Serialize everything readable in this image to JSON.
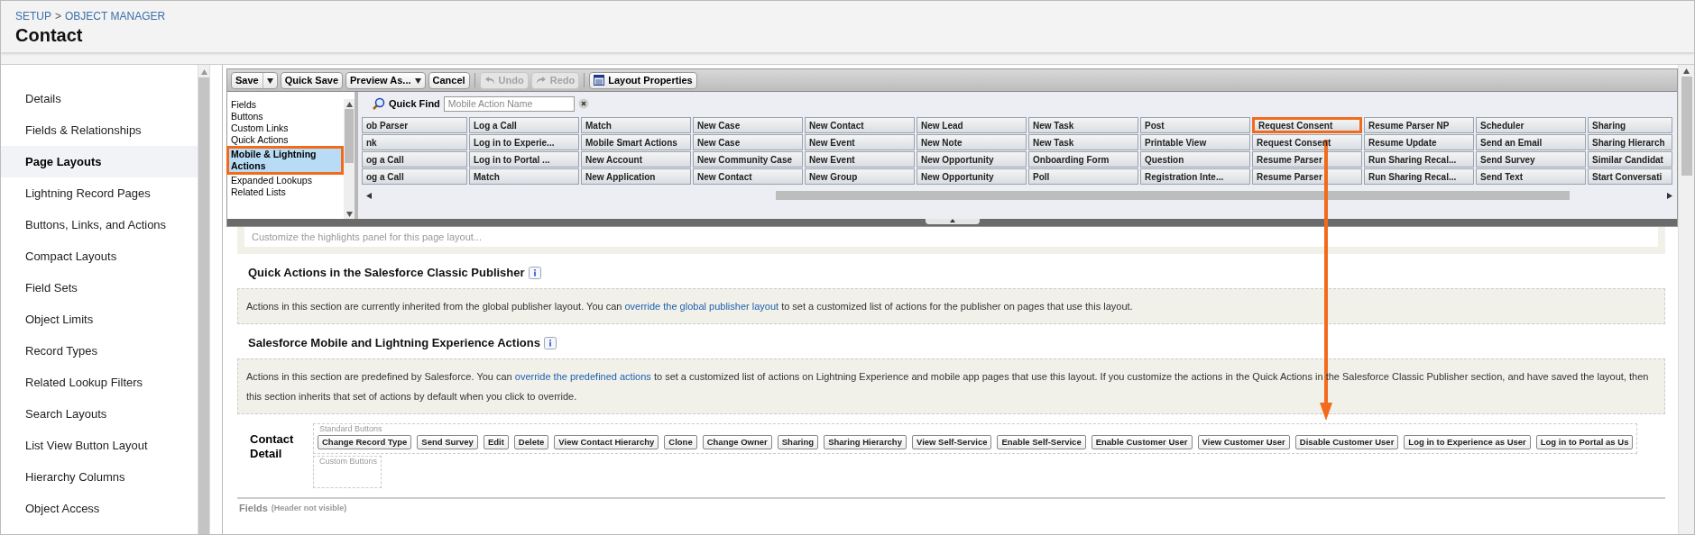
{
  "header": {
    "breadcrumb": [
      "SETUP",
      "OBJECT MANAGER"
    ],
    "separator": ">",
    "title": "Contact"
  },
  "sidebar": {
    "items": [
      {
        "label": "Details",
        "selected": false
      },
      {
        "label": "Fields & Relationships",
        "selected": false
      },
      {
        "label": "Page Layouts",
        "selected": true
      },
      {
        "label": "Lightning Record Pages",
        "selected": false
      },
      {
        "label": "Buttons, Links, and Actions",
        "selected": false
      },
      {
        "label": "Compact Layouts",
        "selected": false
      },
      {
        "label": "Field Sets",
        "selected": false
      },
      {
        "label": "Object Limits",
        "selected": false
      },
      {
        "label": "Record Types",
        "selected": false
      },
      {
        "label": "Related Lookup Filters",
        "selected": false
      },
      {
        "label": "Search Layouts",
        "selected": false
      },
      {
        "label": "List View Button Layout",
        "selected": false
      },
      {
        "label": "Hierarchy Columns",
        "selected": false
      },
      {
        "label": "Object Access",
        "selected": false
      }
    ]
  },
  "toolbar": [
    {
      "label": "Save",
      "kind": "split",
      "disabled": false
    },
    {
      "label": "Quick Save",
      "kind": "button",
      "disabled": false
    },
    {
      "label": "Preview As...",
      "kind": "menu",
      "disabled": false
    },
    {
      "label": "Cancel",
      "kind": "button",
      "disabled": false
    },
    {
      "label": "Undo",
      "kind": "undo",
      "disabled": true
    },
    {
      "label": "Redo",
      "kind": "redo",
      "disabled": true
    },
    {
      "label": "Layout Properties",
      "kind": "properties",
      "disabled": false
    }
  ],
  "palette": {
    "categories": [
      {
        "label": "Fields",
        "selected": false,
        "highlighted": false
      },
      {
        "label": "Buttons",
        "selected": false,
        "highlighted": false
      },
      {
        "label": "Custom Links",
        "selected": false,
        "highlighted": false
      },
      {
        "label": "Quick Actions",
        "selected": false,
        "highlighted": false
      },
      {
        "label": "Mobile & Lightning Actions",
        "selected": true,
        "highlighted": true
      },
      {
        "label": "Expanded Lookups",
        "selected": false,
        "highlighted": false
      },
      {
        "label": "Related Lists",
        "selected": false,
        "highlighted": false
      }
    ],
    "quick_find": {
      "label": "Quick Find",
      "placeholder": "Mobile Action Name"
    },
    "rows": [
      [
        {
          "label": "ob Parser",
          "highlighted": false
        },
        {
          "label": "Log a Call",
          "highlighted": false
        },
        {
          "label": "Match",
          "highlighted": false
        },
        {
          "label": "New Case",
          "highlighted": false
        },
        {
          "label": "New Contact",
          "highlighted": false
        },
        {
          "label": "New Lead",
          "highlighted": false
        },
        {
          "label": "New Task",
          "highlighted": false
        },
        {
          "label": "Post",
          "highlighted": false
        },
        {
          "label": "Request Consent",
          "highlighted": true
        },
        {
          "label": "Resume Parser NP",
          "highlighted": false
        },
        {
          "label": "Scheduler",
          "highlighted": false
        },
        {
          "label": "Sharing",
          "highlighted": false
        }
      ],
      [
        {
          "label": "nk",
          "highlighted": false
        },
        {
          "label": "Log in to Experie...",
          "highlighted": false
        },
        {
          "label": "Mobile Smart Actions",
          "highlighted": false
        },
        {
          "label": "New Case",
          "highlighted": false
        },
        {
          "label": "New Event",
          "highlighted": false
        },
        {
          "label": "New Note",
          "highlighted": false
        },
        {
          "label": "New Task",
          "highlighted": false
        },
        {
          "label": "Printable View",
          "highlighted": false
        },
        {
          "label": "Request Consent",
          "highlighted": false
        },
        {
          "label": "Resume Update",
          "highlighted": false
        },
        {
          "label": "Send an Email",
          "highlighted": false
        },
        {
          "label": "Sharing Hierarch",
          "highlighted": false
        }
      ],
      [
        {
          "label": "og a Call",
          "highlighted": false
        },
        {
          "label": "Log in to Portal ...",
          "highlighted": false
        },
        {
          "label": "New Account",
          "highlighted": false
        },
        {
          "label": "New Community Case",
          "highlighted": false
        },
        {
          "label": "New Event",
          "highlighted": false
        },
        {
          "label": "New Opportunity",
          "highlighted": false
        },
        {
          "label": "Onboarding Form",
          "highlighted": false
        },
        {
          "label": "Question",
          "highlighted": false
        },
        {
          "label": "Resume Parser",
          "highlighted": false
        },
        {
          "label": "Run Sharing Recal...",
          "highlighted": false
        },
        {
          "label": "Send Survey",
          "highlighted": false
        },
        {
          "label": "Similar Candidat",
          "highlighted": false
        }
      ],
      [
        {
          "label": "og a Call",
          "highlighted": false
        },
        {
          "label": "Match",
          "highlighted": false
        },
        {
          "label": "New Application",
          "highlighted": false
        },
        {
          "label": "New Contact",
          "highlighted": false
        },
        {
          "label": "New Group",
          "highlighted": false
        },
        {
          "label": "New Opportunity",
          "highlighted": false
        },
        {
          "label": "Poll",
          "highlighted": false
        },
        {
          "label": "Registration Inte...",
          "highlighted": false
        },
        {
          "label": "Resume Parser",
          "highlighted": false
        },
        {
          "label": "Run Sharing Recal...",
          "highlighted": false
        },
        {
          "label": "Send Text",
          "highlighted": false
        },
        {
          "label": "Start Conversati",
          "highlighted": false
        }
      ]
    ]
  },
  "highlights_panel": {
    "hint": "Customize the highlights panel for this page layout..."
  },
  "sections": [
    {
      "title": "Quick Actions in the Salesforce Classic Publisher",
      "text_before": "Actions in this section are currently inherited from the global publisher layout. You can ",
      "link": "override the global publisher layout",
      "text_after": " to set a customized list of actions for the publisher on pages that use this layout."
    },
    {
      "title": "Salesforce Mobile and Lightning Experience Actions",
      "text_before": "Actions in this section are predefined by Salesforce. You can ",
      "link": "override the predefined actions",
      "text_after": " to set a customized list of actions on Lightning Experience and mobile app pages that use this layout. If you customize the actions in the Quick Actions in the Salesforce Classic Publisher section, and have saved the layout, then this section inherits that set of actions by default when you click to override."
    }
  ],
  "detail": {
    "title": "Contact Detail",
    "standard_label": "Standard Buttons",
    "standard_buttons": [
      "Change Record Type",
      "Send Survey",
      "Edit",
      "Delete",
      "View Contact Hierarchy",
      "Clone",
      "Change Owner",
      "Sharing",
      "Sharing Hierarchy",
      "View Self-Service",
      "Enable Self-Service",
      "Enable Customer User",
      "View Customer User",
      "Disable Customer User",
      "Log in to Experience as User",
      "Log in to Portal as Us"
    ],
    "custom_label": "Custom Buttons"
  },
  "fields_section": {
    "title": "Fields",
    "note": "(Header not visible)"
  }
}
